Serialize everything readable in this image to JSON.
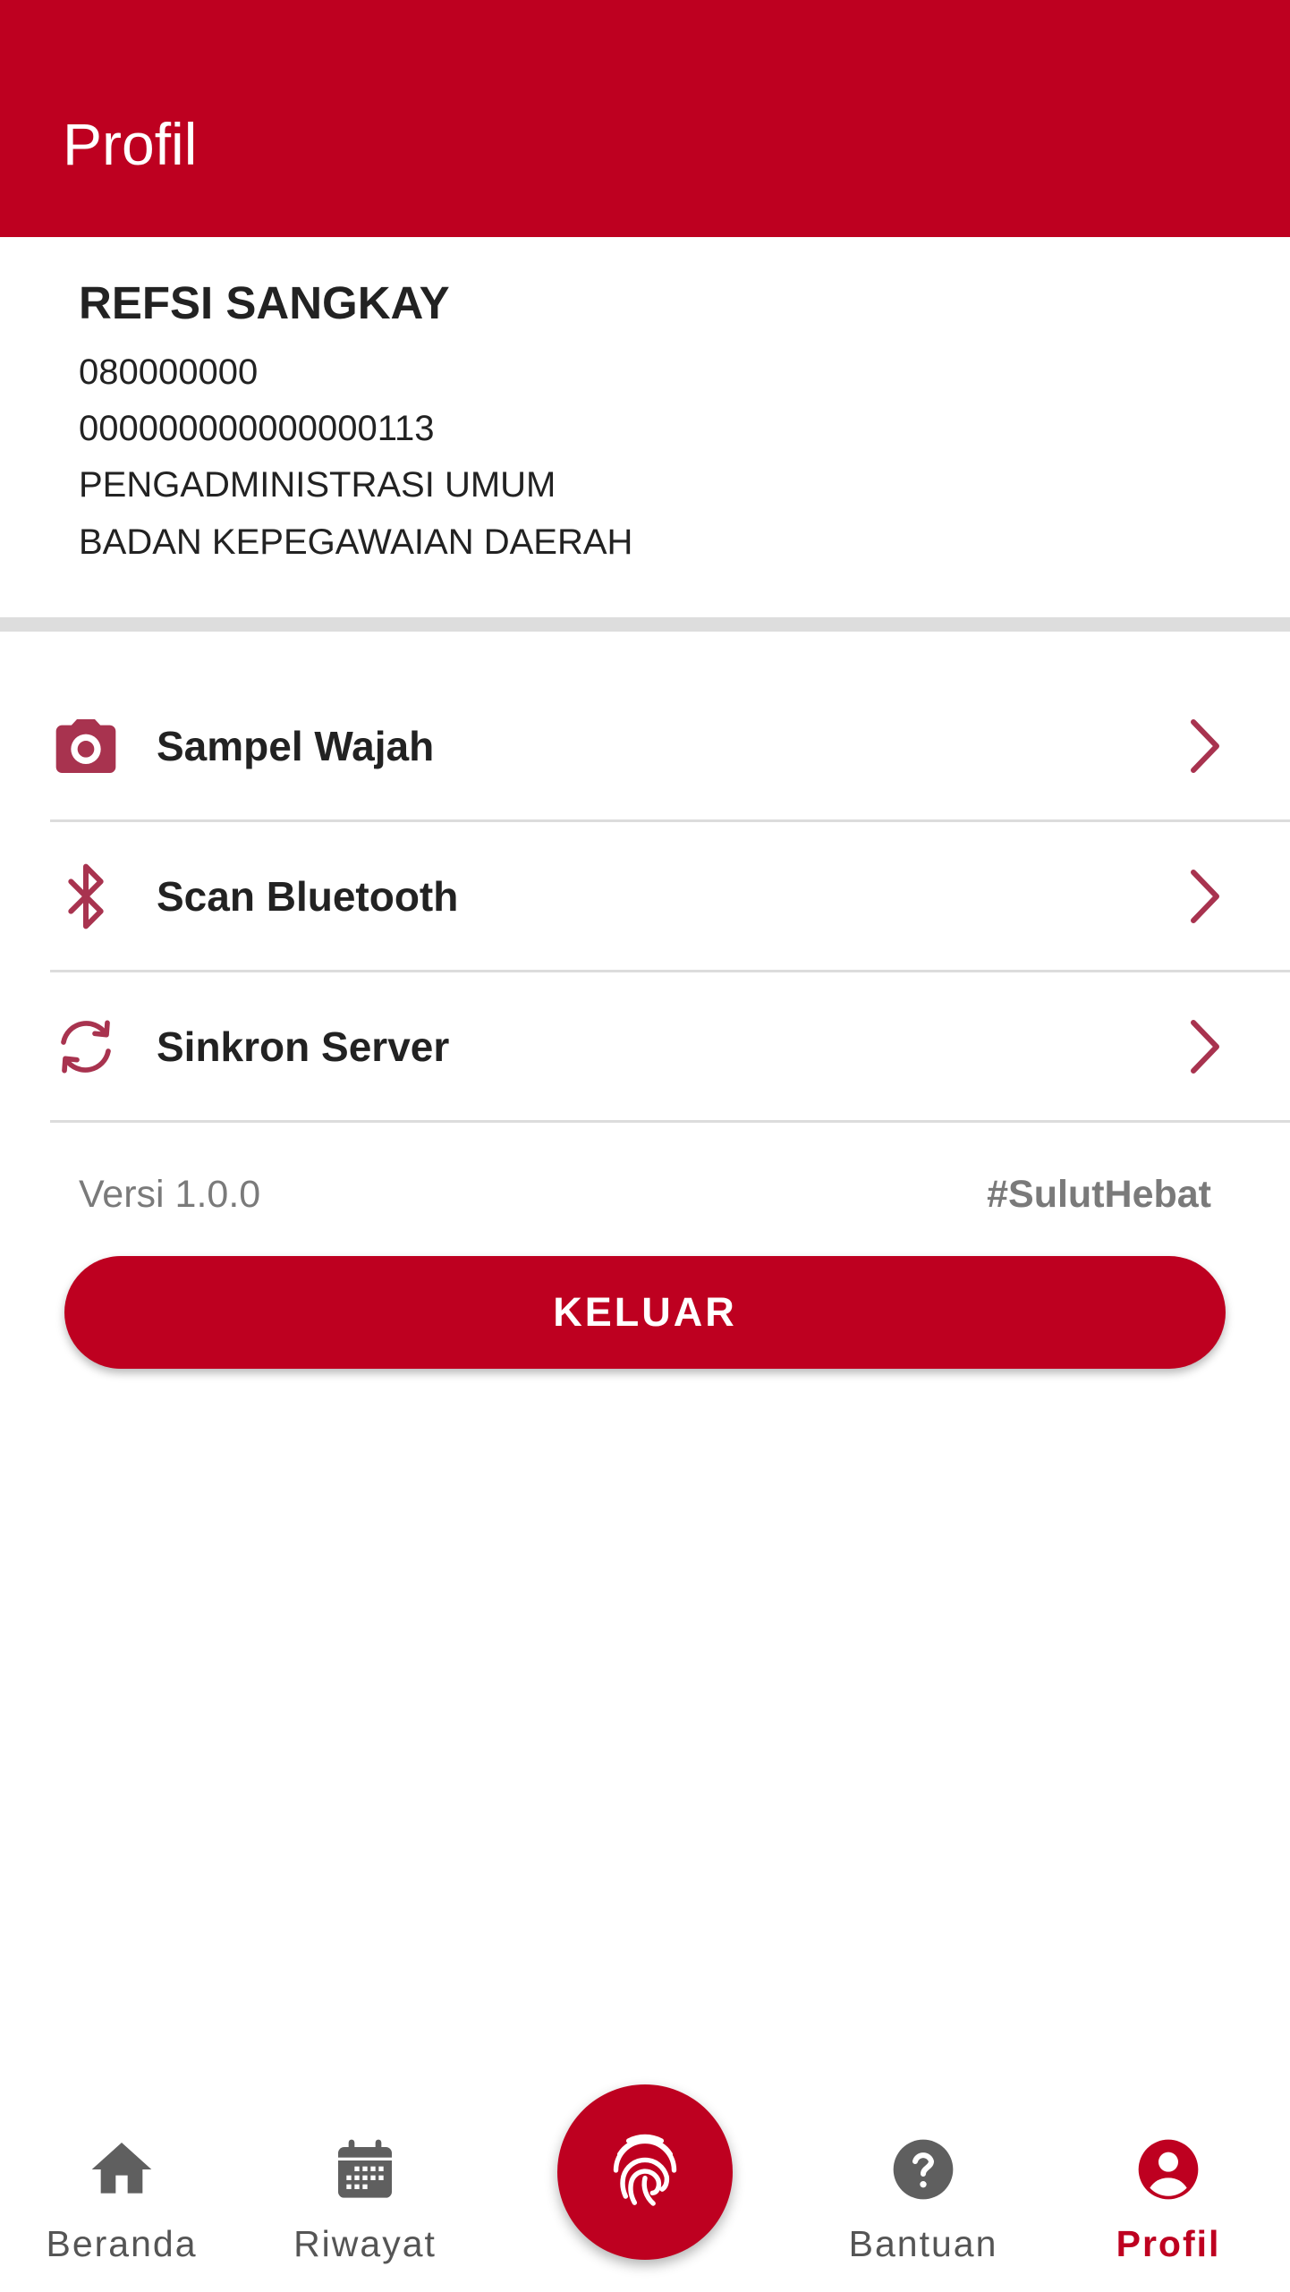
{
  "appbar": {
    "title": "Profil"
  },
  "profile": {
    "name": "REFSI SANGKAY",
    "phone": "080000000",
    "nip": "000000000000000113",
    "position": "PENGADMINISTRASI UMUM",
    "unit": "BADAN KEPEGAWAIAN DAERAH"
  },
  "menu": [
    {
      "label": "Sampel Wajah",
      "icon": "camera-icon"
    },
    {
      "label": "Scan Bluetooth",
      "icon": "bluetooth-icon"
    },
    {
      "label": "Sinkron Server",
      "icon": "sync-icon"
    }
  ],
  "footer": {
    "version": "Versi 1.0.0",
    "hashtag": "#SulutHebat",
    "logout_label": "KELUAR"
  },
  "nav": [
    {
      "label": "Beranda",
      "icon": "home-icon",
      "active": false
    },
    {
      "label": "Riwayat",
      "icon": "calendar-icon",
      "active": false
    },
    {
      "label": "Bantuan",
      "icon": "help-icon",
      "active": false
    },
    {
      "label": "Profil",
      "icon": "account-icon",
      "active": true
    }
  ],
  "fab": {
    "icon": "fingerprint-icon"
  },
  "colors": {
    "primary": "#be0020",
    "menu_icon": "#a8334f",
    "nav_inactive": "#555555"
  }
}
